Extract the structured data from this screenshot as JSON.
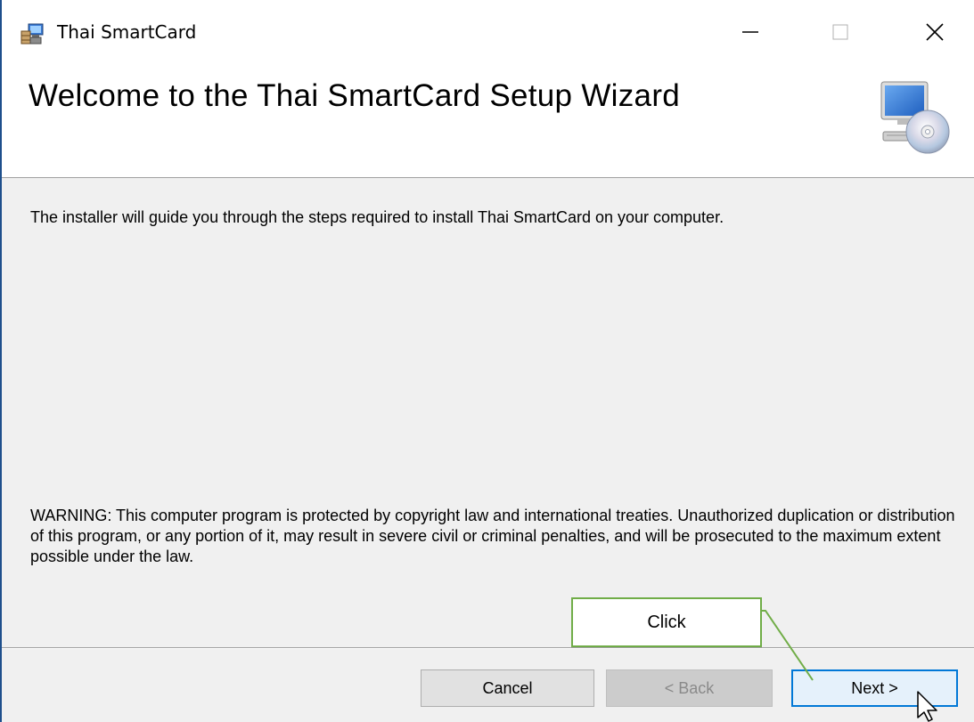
{
  "window": {
    "title": "Thai SmartCard",
    "controls": {
      "minimize": "minimize",
      "maximize": "maximize",
      "close": "close"
    }
  },
  "banner": {
    "title": "Welcome to the Thai SmartCard Setup Wizard",
    "icon": "computer-cd-icon"
  },
  "body": {
    "intro": "The installer will guide you through the steps required to install Thai SmartCard on your computer.",
    "warning": "WARNING: This computer program is protected by copyright law and international treaties. Unauthorized duplication or distribution of this program, or any portion of it, may result in severe civil or criminal penalties, and will be prosecuted to the maximum extent possible under the law."
  },
  "buttons": {
    "cancel": "Cancel",
    "back": "< Back",
    "next": "Next >"
  },
  "annotation": {
    "label": "Click",
    "color": "#70ad47"
  },
  "colors": {
    "accent": "#0078d7",
    "window_border": "#1e4f8c"
  }
}
